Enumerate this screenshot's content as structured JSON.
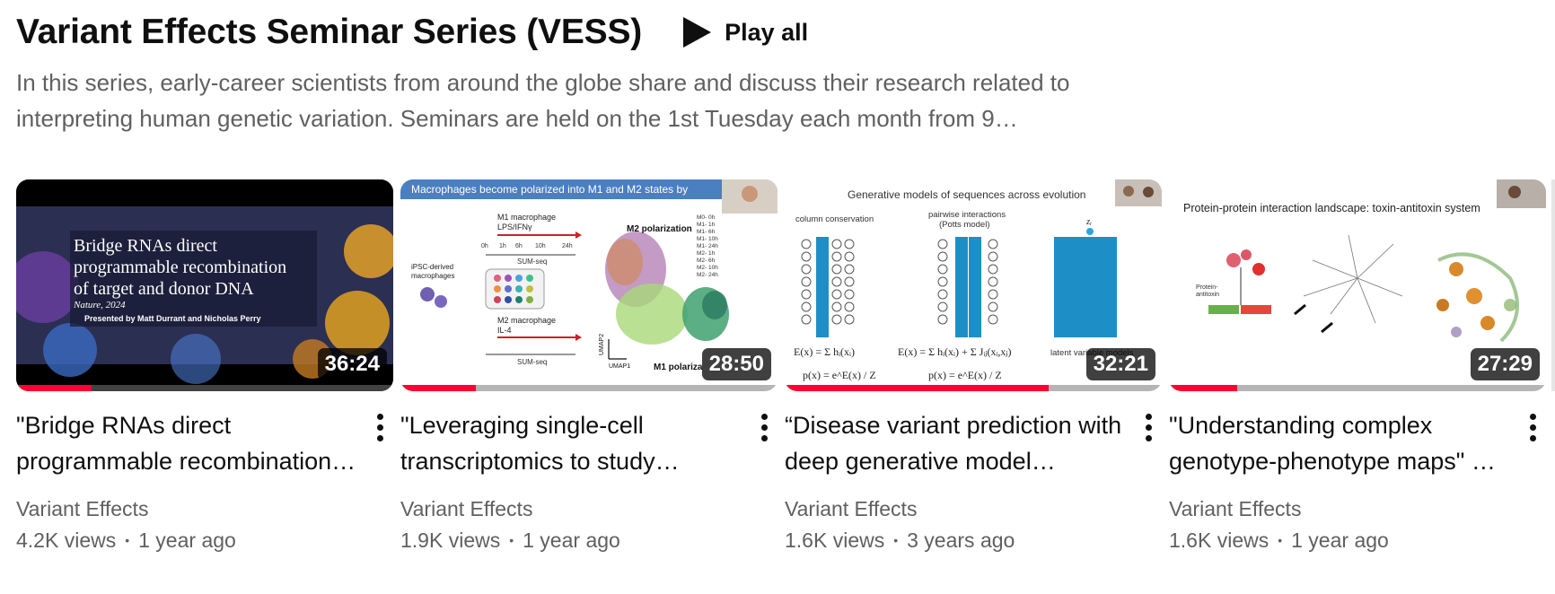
{
  "shelf": {
    "title": "Variant Effects Seminar Series (VESS)",
    "play_all_label": "Play all",
    "description": "In this series, early-career scientists from around the globe share and discuss their research related to interpreting human genetic variation. Seminars are held on the 1st Tuesday each month from 9…"
  },
  "videos": [
    {
      "title": "\"Bridge RNAs direct programmable recombination of target and donor DNA\"",
      "channel": "Variant Effects",
      "views": "4.2K views",
      "age": "1 year ago",
      "duration": "36:24",
      "watched_fraction": 0.2,
      "thumb": {
        "l1": "Bridge RNAs direct",
        "l2": "programmable recombination",
        "l3": "of target and donor DNA",
        "l4": "Nature, 2024",
        "l5": "Presented by Matt Durrant and Nicholas Perry"
      }
    },
    {
      "title": "\"Leveraging single-cell transcriptomics to study…",
      "channel": "Variant Effects",
      "views": "1.9K views",
      "age": "1 year ago",
      "duration": "28:50",
      "watched_fraction": 0.2,
      "thumb": {
        "banner": "Macrophages become polarized into M1 and M2 states by",
        "m1": "M1 macrophage",
        "m1sub": "LPS/IFNγ",
        "m2": "M2 macrophage",
        "m2sub": "IL-4",
        "ipsc": "iPSC-derived",
        "ipsc2": "macrophages",
        "sumseq": "SUM-seq",
        "umap_title": "M2 polarization",
        "umap_bottom": "M1 polariza",
        "umap2": "UMAP2",
        "umap1": "UMAP1",
        "t0": "0h",
        "t1": "1h",
        "t6": "6h",
        "t10": "10h",
        "t24": "24h",
        "legend": [
          "M0- 0h",
          "M1- 1h",
          "M1- 6h",
          "M1- 10h",
          "M1- 24h",
          "M2- 1h",
          "M2- 6h",
          "M2- 10h",
          "M2- 24h"
        ]
      }
    },
    {
      "title": "“Disease variant prediction with deep generative model…",
      "channel": "Variant Effects",
      "views": "1.6K views",
      "age": "3 years ago",
      "duration": "32:21",
      "watched_fraction": 0.7,
      "thumb": {
        "heading": "Generative models of sequences across evolution",
        "c1": "column conservation",
        "c2": "pairwise interactions",
        "c2b": "(Potts model)",
        "c3": "latent variable models",
        "zi": "zᵢ"
      }
    },
    {
      "title": "\"Understanding complex genotype-phenotype maps\" …",
      "channel": "Variant Effects",
      "views": "1.6K views",
      "age": "1 year ago",
      "duration": "27:29",
      "watched_fraction": 0.18,
      "thumb": {
        "heading": "Protein-protein interaction landscape: toxin-antitoxin system",
        "pa": "Protein-",
        "pa2": "antitoxin"
      }
    }
  ]
}
